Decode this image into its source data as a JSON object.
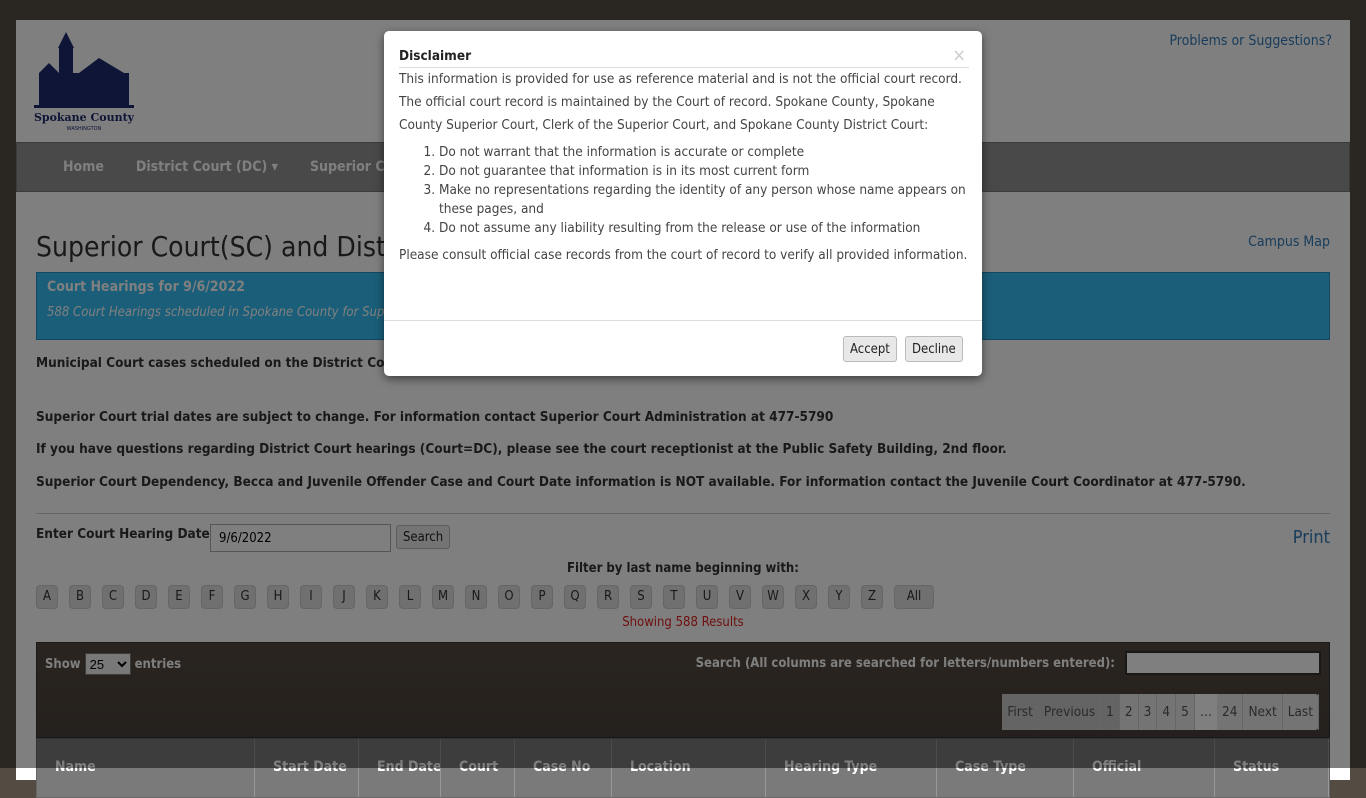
{
  "header": {
    "logo_text": "Spokane County",
    "logo_sub": "WASHINGTON",
    "problems_link": "Problems or Suggestions?"
  },
  "nav": [
    "Home",
    "District Court (DC) ▾",
    "Superior Court"
  ],
  "page_title": "Superior Court(SC) and District Court(DC) Hearings",
  "campus_map": "Campus Map",
  "info": {
    "title": "Court Hearings for 9/6/2022",
    "subtitle": "588 Court Hearings scheduled in Spokane County for Superior Court and District Court"
  },
  "paragraphs": [
    "Municipal Court cases scheduled on the District Court calendar are held at this location in Courtroom 1 (AM) and Courtroom 4 (PM).",
    "Superior Court trial dates are subject to change. For information contact Superior Court Administration at 477-5790",
    "If you have questions regarding District Court hearings (Court=DC), please see the court receptionist at the Public Safety Building, 2nd floor.",
    "Superior Court Dependency, Becca and Juvenile Offender Case and Court Date information is NOT available. For information contact the Juvenile Court Coordinator at 477-5790."
  ],
  "date_form": {
    "label": "Enter Court Hearing Date:",
    "value": "9/6/2022",
    "search": "Search",
    "print": "Print"
  },
  "filter": {
    "label": "Filter by last name beginning with:",
    "letters": [
      "A",
      "B",
      "C",
      "D",
      "E",
      "F",
      "G",
      "H",
      "I",
      "J",
      "K",
      "L",
      "M",
      "N",
      "O",
      "P",
      "Q",
      "R",
      "S",
      "T",
      "U",
      "V",
      "W",
      "X",
      "Y",
      "Z"
    ],
    "all": "All",
    "showing": "Showing 588 Results"
  },
  "table": {
    "show": "Show",
    "entries_value": "25",
    "entries": "entries",
    "search_label": "Search (All columns are searched for letters/numbers entered):",
    "pager": [
      "First",
      "Previous",
      "1",
      "2",
      "3",
      "4",
      "5",
      "…",
      "24",
      "Next",
      "Last"
    ],
    "headers": [
      "Name",
      "Start Date",
      "End Date",
      "Court",
      "Case No",
      "Location",
      "Hearing Type",
      "Case Type",
      "Official",
      "Status"
    ]
  },
  "modal": {
    "title": "Disclaimer",
    "close": "×",
    "intro": "This information is provided for use as reference material and is not the official court record. The official court record is maintained by the Court of record. Spokane County, Spokane County Superior Court, Clerk of the Superior Court, and Spokane County District Court:",
    "items": [
      "Do not warrant that the information is accurate or complete",
      "Do not guarantee that information is in its most current form",
      "Make no representations regarding the identity of any person whose name appears on these pages, and",
      "Do not assume any liability resulting from the release or use of the information"
    ],
    "outro": "Please consult official case records from the court of record to verify all provided information.",
    "accept": "Accept",
    "decline": "Decline"
  },
  "colors": {
    "info_bg": "#34bdf2",
    "link": "#337ab7",
    "showing": "#e02020"
  }
}
